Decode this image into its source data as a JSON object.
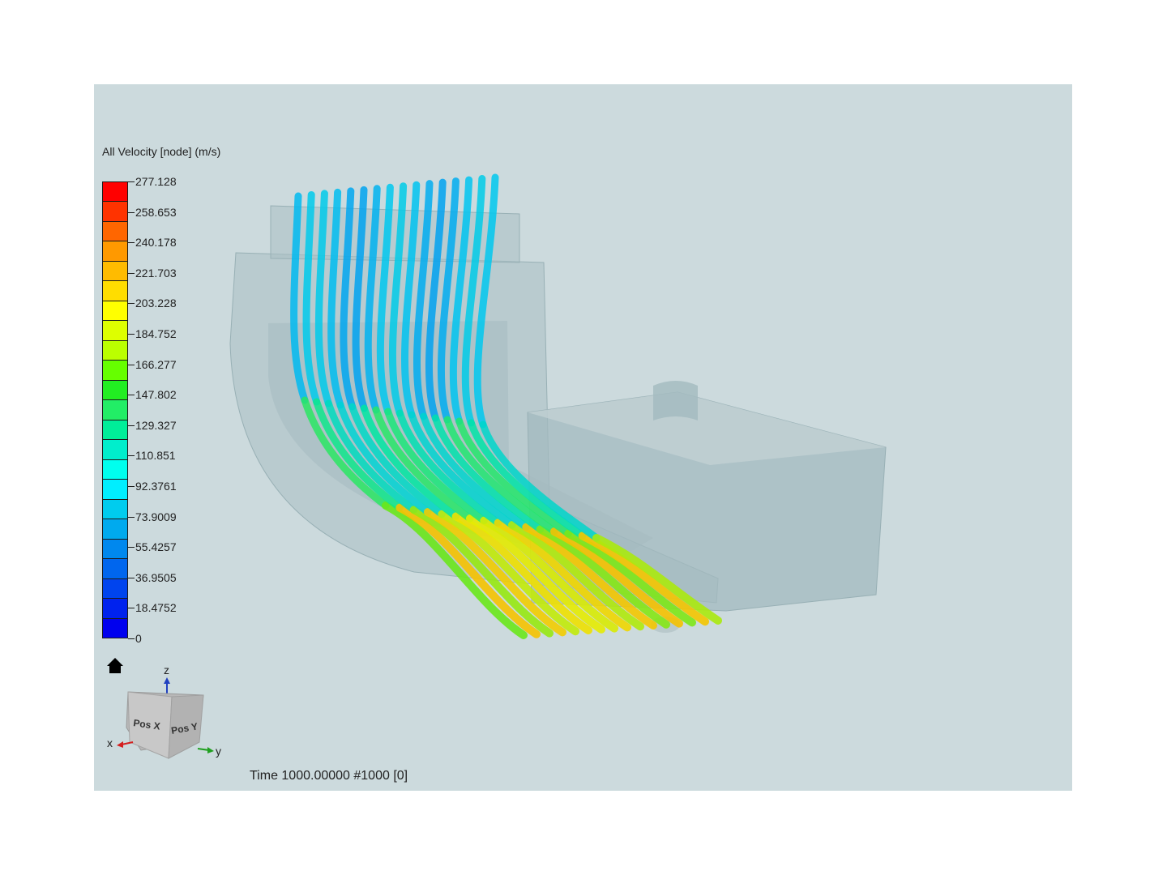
{
  "legend": {
    "title": "All Velocity [node] (m/s)",
    "tick_labels": [
      "277.128",
      "258.653",
      "240.178",
      "221.703",
      "203.228",
      "184.752",
      "166.277",
      "147.802",
      "129.327",
      "110.851",
      "92.3761",
      "73.9009",
      "55.4257",
      "36.9505",
      "18.4752",
      "0"
    ],
    "colors": [
      "#ff0000",
      "#ff3300",
      "#ff6600",
      "#ff9900",
      "#ffbb00",
      "#ffdd00",
      "#ffff00",
      "#ddff00",
      "#bbff00",
      "#66ff00",
      "#22ee22",
      "#22ee66",
      "#00ee99",
      "#00eecc",
      "#00ffee",
      "#00eeff",
      "#00ccee",
      "#00aaee",
      "#0088ee",
      "#0066ee",
      "#0044ee",
      "#0022ee",
      "#0000ee"
    ],
    "range": [
      0,
      277.128
    ],
    "unit": "m/s"
  },
  "axes_widget": {
    "z_label": "z",
    "x_label": "x",
    "y_label": "y",
    "face_pos_x": "Pos X",
    "face_pos_y": "Pos Y",
    "home_icon": "home-icon"
  },
  "status": {
    "time_text": "Time 1000.00000  #1000 [0]"
  },
  "colors": {
    "background": "#ccdadd",
    "geometry": "#a9bfc3",
    "accent_x": "#d42020",
    "accent_y": "#20a020",
    "accent_z": "#2040c0"
  }
}
